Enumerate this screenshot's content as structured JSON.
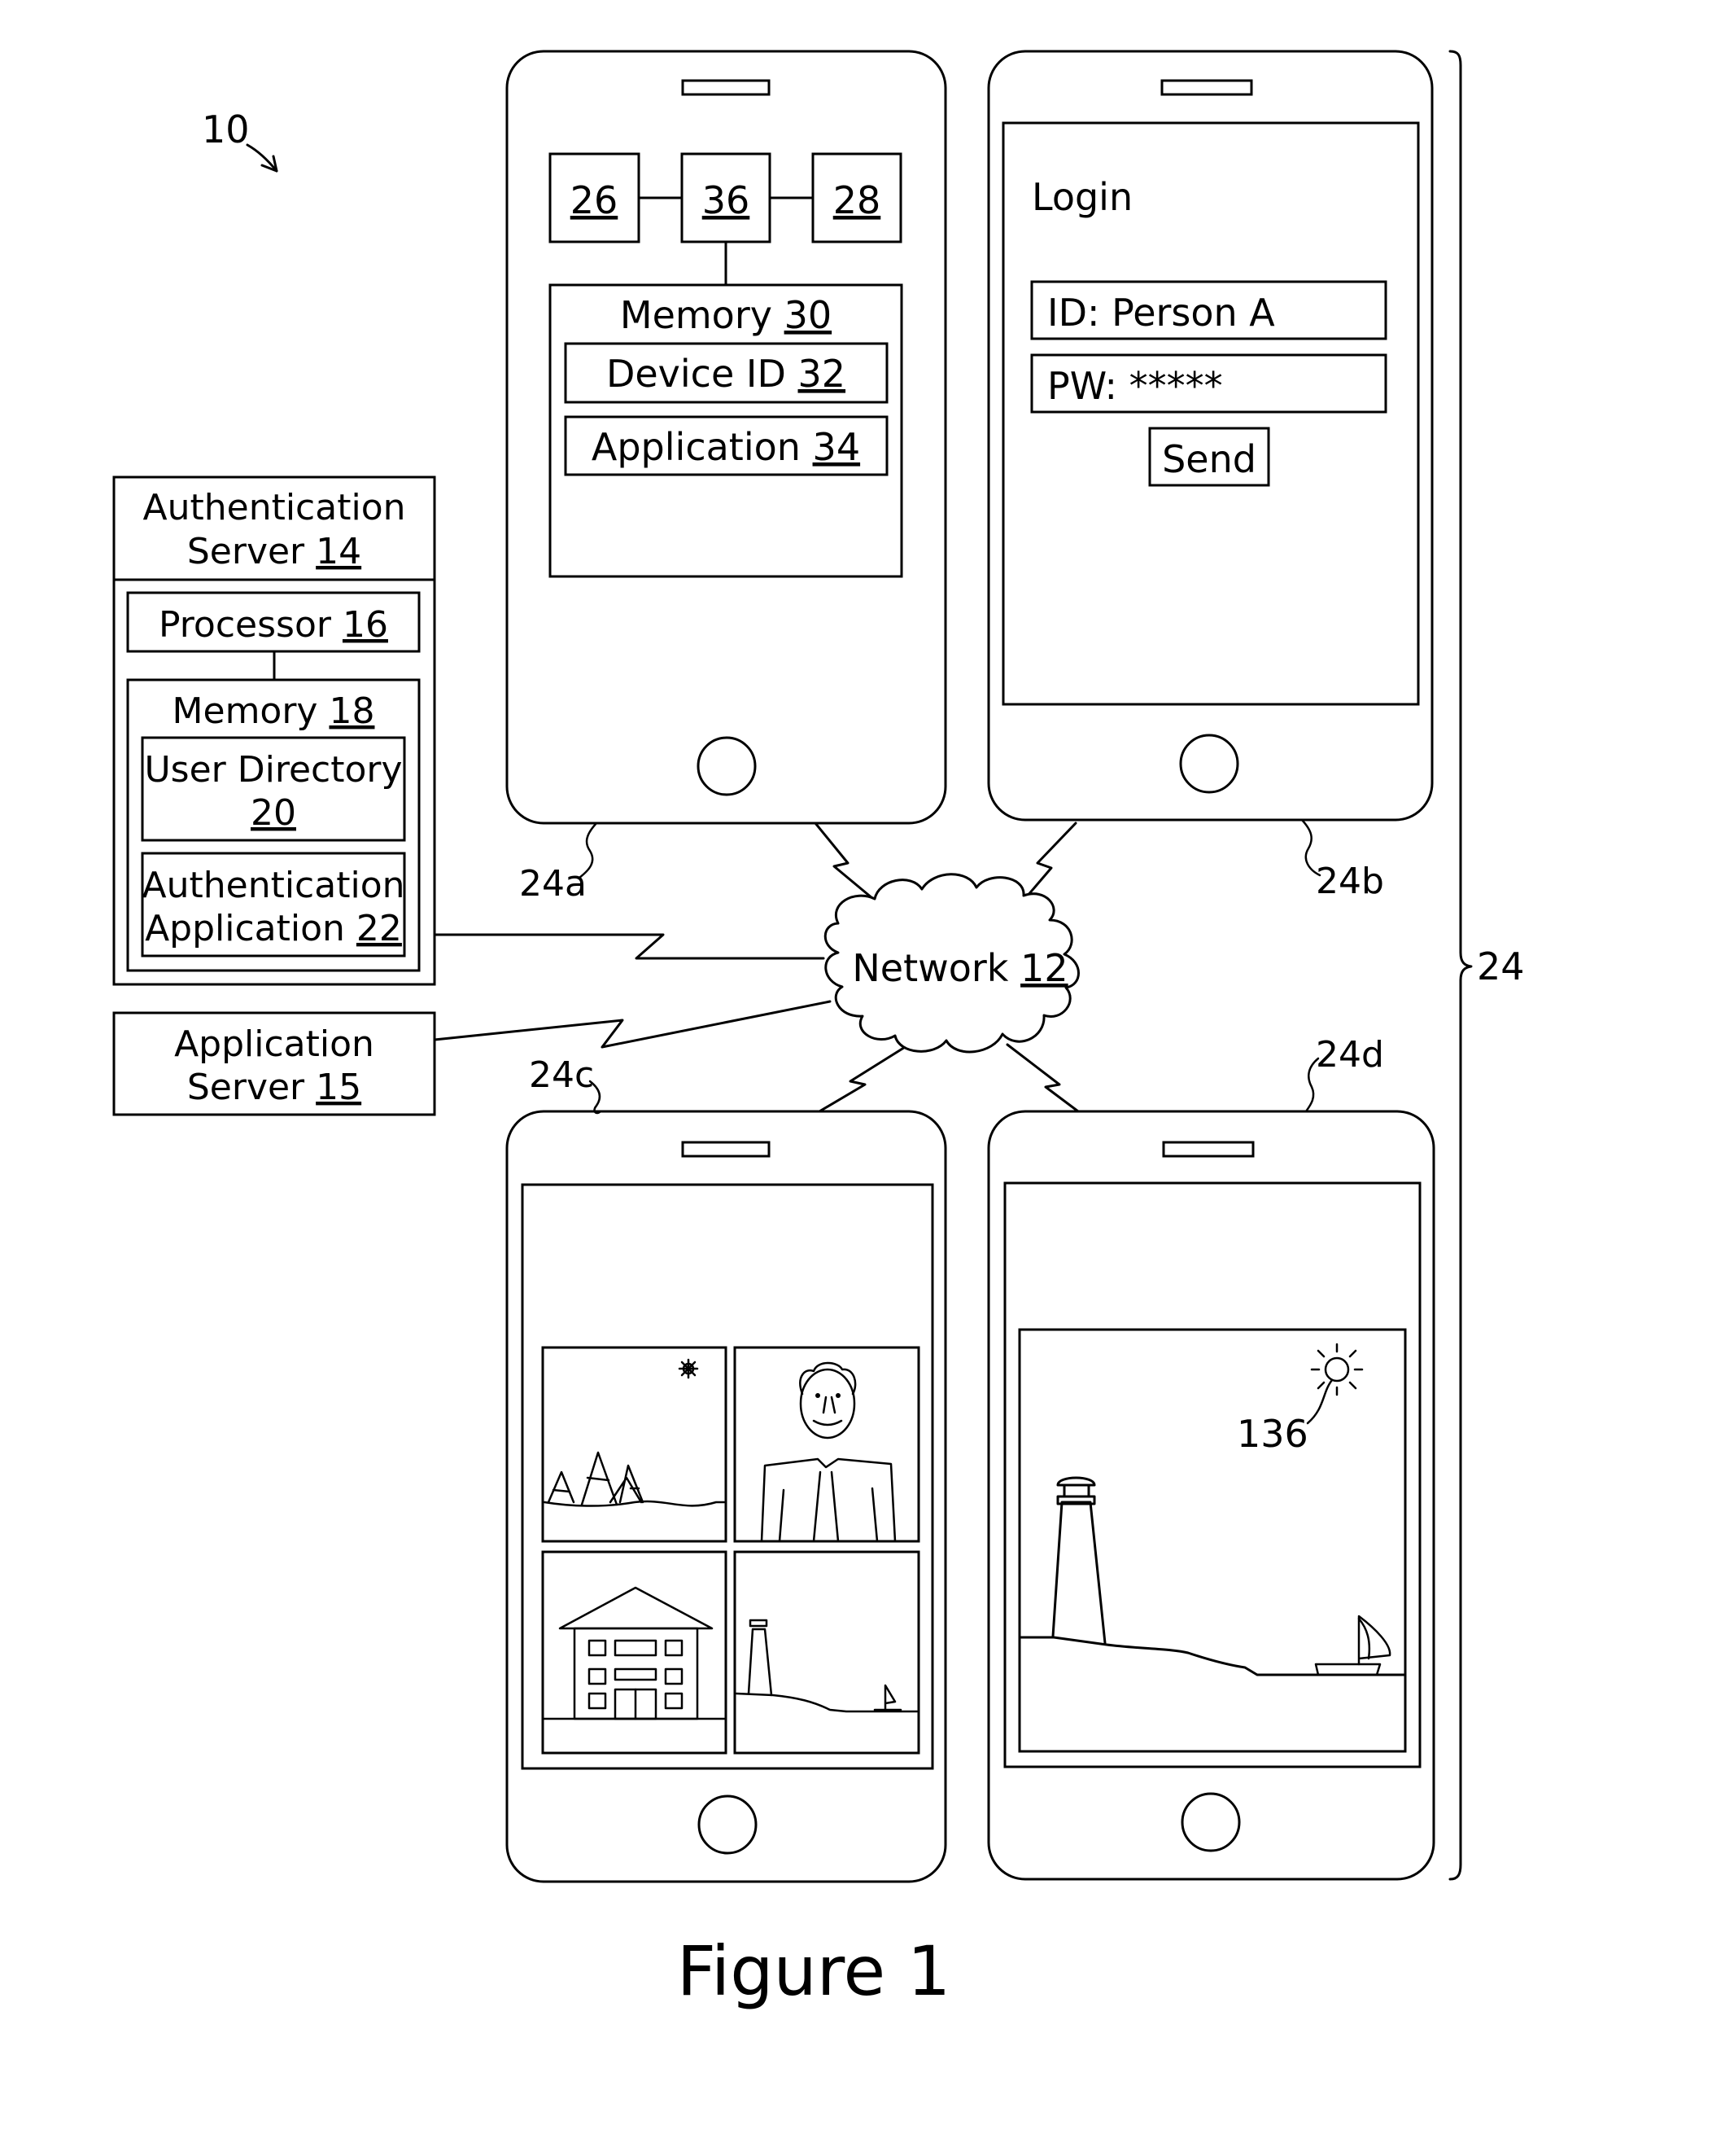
{
  "figure": {
    "caption": "Figure 1",
    "system_ref": "10"
  },
  "auth_server": {
    "title_line1": "Authentication",
    "title_line2": "Server ",
    "title_ref": "14",
    "processor_label": "Processor ",
    "processor_ref": "16",
    "memory_label": "Memory ",
    "memory_ref": "18",
    "user_directory_label": "User Directory",
    "user_directory_ref": "20",
    "auth_app_line1": "Authentication",
    "auth_app_line2": "Application ",
    "auth_app_ref": "22"
  },
  "app_server": {
    "title_line1": "Application",
    "title_line2": "Server ",
    "title_ref": "15"
  },
  "network": {
    "label": "Network ",
    "ref": "12"
  },
  "devices": {
    "group_ref": "24",
    "device_a": {
      "ref": "24a",
      "component_left": "26",
      "component_center": "36",
      "component_right": "28",
      "memory_label": "Memory ",
      "memory_ref": "30",
      "device_id_label": "Device ID ",
      "device_id_ref": "32",
      "application_label": "Application ",
      "application_ref": "34"
    },
    "device_b": {
      "ref": "24b",
      "login_title": "Login",
      "id_field": "ID: Person A",
      "pw_field": "PW: *****",
      "send_button": "Send"
    },
    "device_c": {
      "ref": "24c",
      "thumbnails": [
        "winter-trees-scene",
        "person-portrait",
        "building",
        "lighthouse-scene"
      ]
    },
    "device_d": {
      "ref": "24d",
      "image": "lighthouse-scene-enlarged",
      "sun_ref": "136"
    }
  }
}
